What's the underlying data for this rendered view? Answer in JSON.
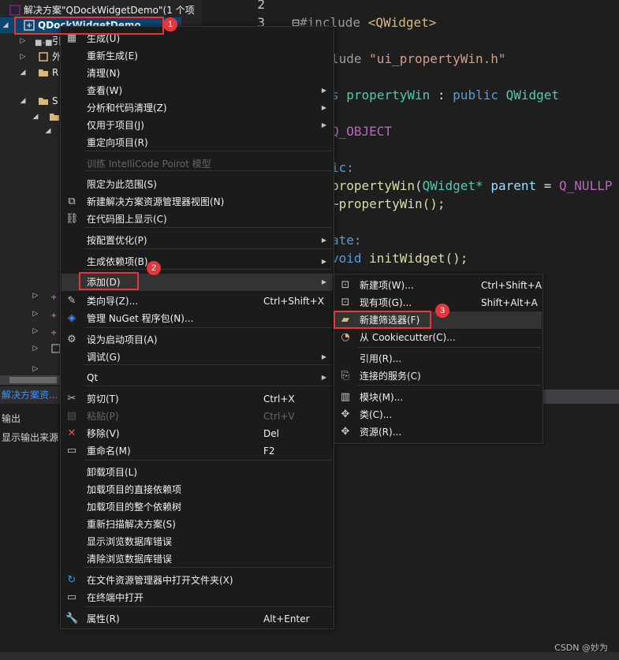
{
  "solution_explorer": {
    "solution_title": "解决方案\"QDockWidgetDemo\"(1 个项",
    "project_name": "QDockWidgetDemo",
    "tree_fragments": [
      "引",
      "外",
      "R",
      "S"
    ],
    "panel_tab": "解决方案资...",
    "output_title": "输出",
    "output_source": "显示输出来源"
  },
  "editor": {
    "lines": [
      {
        "num": "2"
      },
      {
        "num": "3"
      }
    ],
    "code": {
      "line3_include": "#include",
      "line3_header": "<QWidget>",
      "line4_include": "lude",
      "line4_header": "\"ui_propertyWin.h\"",
      "line6_keyword": "s",
      "line6_class": "propertyWin",
      "line6_colon": ":",
      "line6_public": "public",
      "line6_base": "QWidget",
      "line8_macro": "Q_OBJECT",
      "line10_access": "ic:",
      "line11_ctor": "propertyWin",
      "line11_param_type": "QWidget*",
      "line11_param": "parent",
      "line11_eq": "=",
      "line11_default": "Q_NULLP",
      "line12_dtor": "~propertyWin();",
      "line14_access": "ate:",
      "line15_void": "void",
      "line15_fn": "initWidget();"
    }
  },
  "context_menu": {
    "items": [
      {
        "label": "生成(U)",
        "icon": "build-icon"
      },
      {
        "label": "重新生成(E)"
      },
      {
        "label": "清理(N)"
      },
      {
        "label": "查看(W)",
        "submenu": true
      },
      {
        "label": "分析和代码清理(Z)",
        "submenu": true
      },
      {
        "label": "仅用于项目(J)",
        "submenu": true
      },
      {
        "label": "重定向项目(R)"
      },
      {
        "label": "训练 IntelliCode Poirot 模型",
        "disabled": true
      },
      {
        "label": "限定为此范围(S)"
      },
      {
        "label": "新建解决方案资源管理器视图(N)",
        "icon": "new-view-icon"
      },
      {
        "label": "在代码图上显示(C)",
        "icon": "code-map-icon"
      },
      {
        "label": "按配置优化(P)",
        "submenu": true
      },
      {
        "label": "生成依赖项(B)",
        "submenu": true
      },
      {
        "label": "添加(D)",
        "submenu": true
      },
      {
        "label": "类向导(Z)...",
        "shortcut": "Ctrl+Shift+X",
        "icon": "class-wizard-icon"
      },
      {
        "label": "管理 NuGet 程序包(N)...",
        "icon": "nuget-icon"
      },
      {
        "label": "设为启动项目(A)",
        "icon": "gear-icon"
      },
      {
        "label": "调试(G)",
        "submenu": true
      },
      {
        "label": "Qt",
        "submenu": true
      },
      {
        "label": "剪切(T)",
        "shortcut": "Ctrl+X",
        "icon": "scissors-icon"
      },
      {
        "label": "粘贴(P)",
        "shortcut": "Ctrl+V",
        "disabled": true,
        "icon": "paste-icon"
      },
      {
        "label": "移除(V)",
        "shortcut": "Del",
        "icon": "remove-icon"
      },
      {
        "label": "重命名(M)",
        "shortcut": "F2",
        "icon": "rename-icon"
      },
      {
        "label": "卸载项目(L)"
      },
      {
        "label": "加载项目的直接依赖项"
      },
      {
        "label": "加载项目的整个依赖树"
      },
      {
        "label": "重新扫描解决方案(S)"
      },
      {
        "label": "显示浏览数据库错误"
      },
      {
        "label": "清除浏览数据库错误"
      },
      {
        "label": "在文件资源管理器中打开文件夹(X)",
        "icon": "open-folder-icon"
      },
      {
        "label": "在终端中打开",
        "icon": "terminal-icon"
      },
      {
        "label": "属性(R)",
        "shortcut": "Alt+Enter",
        "icon": "wrench-icon"
      }
    ]
  },
  "add_submenu": {
    "items": [
      {
        "label": "新建项(W)...",
        "shortcut": "Ctrl+Shift+A",
        "icon": "new-item-icon"
      },
      {
        "label": "现有项(G)...",
        "shortcut": "Shift+Alt+A",
        "icon": "existing-item-icon"
      },
      {
        "label": "新建筛选器(F)",
        "icon": "new-filter-icon"
      },
      {
        "label": "从 Cookiecutter(C)...",
        "icon": "cookiecutter-icon"
      },
      {
        "label": "引用(R)..."
      },
      {
        "label": "连接的服务(C)",
        "icon": "connected-service-icon"
      },
      {
        "label": "模块(M)...",
        "icon": "module-icon"
      },
      {
        "label": "类(C)...",
        "icon": "class-icon"
      },
      {
        "label": "资源(R)...",
        "icon": "resource-icon"
      }
    ]
  },
  "annotations": [
    "1",
    "2",
    "3"
  ],
  "colors": {
    "accent": "#094771",
    "annotation": "#e8353a",
    "menu_bg": "#1b1b1c"
  },
  "watermark": "CSDN @妙为"
}
